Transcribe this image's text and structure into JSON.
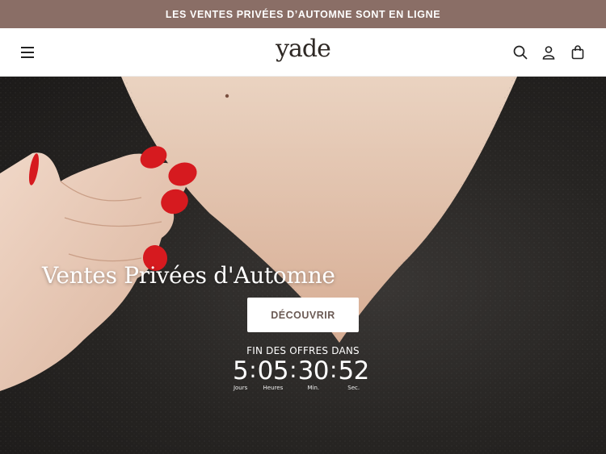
{
  "announcement": "LES VENTES PRIVÉES D’AUTOMNE SONT EN LIGNE",
  "header": {
    "logo": "yade",
    "icons": [
      "menu-icon",
      "search-icon",
      "account-icon",
      "cart-icon"
    ]
  },
  "hero": {
    "title": "Ventes Privées d'Automne",
    "cta_label": "DÉCOUVRIR",
    "offers_label": "FIN DES OFFRES DANS",
    "countdown": {
      "days": "5",
      "hours": "05",
      "minutes": "30",
      "seconds": "52",
      "days_label": "Jours",
      "hours_label": "Heures",
      "minutes_label": "Min.",
      "seconds_label": "Sec."
    }
  },
  "colors": {
    "announcement_bg": "#8a6e66",
    "cta_text": "#6b5a54"
  }
}
